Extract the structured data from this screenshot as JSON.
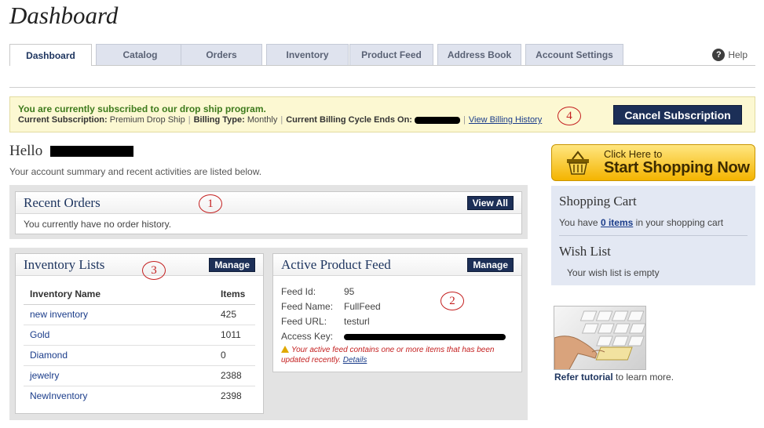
{
  "page": {
    "title": "Dashboard"
  },
  "nav": {
    "tabs": [
      {
        "label": "Dashboard",
        "active": true
      },
      {
        "label": "Catalog"
      },
      {
        "label": "Orders"
      },
      {
        "label": "Inventory"
      },
      {
        "label": "Product Feed"
      },
      {
        "label": "Address Book"
      },
      {
        "label": "Account Settings"
      }
    ],
    "help_label": "Help",
    "help_icon": "question-icon"
  },
  "subscription": {
    "headline": "You are currently subscribed to our drop ship program.",
    "current_label": "Current Subscription:",
    "current_value": "Premium Drop Ship",
    "billing_type_label": "Billing Type:",
    "billing_type_value": "Monthly",
    "cycle_label": "Current Billing Cycle Ends On:",
    "history_link": "View Billing History",
    "cancel_button": "Cancel Subscription"
  },
  "annotations": [
    "1",
    "2",
    "3",
    "4"
  ],
  "greeting": {
    "hello": "Hello",
    "summary": "Your account summary and recent activities are listed below."
  },
  "recent_orders": {
    "title": "Recent Orders",
    "button": "View All",
    "empty_text": "You currently have no order history."
  },
  "inventory_lists": {
    "title": "Inventory Lists",
    "button": "Manage",
    "columns": [
      "Inventory Name",
      "Items"
    ],
    "rows": [
      {
        "name": "new inventory",
        "items": "425"
      },
      {
        "name": "Gold",
        "items": "1011"
      },
      {
        "name": "Diamond",
        "items": "0"
      },
      {
        "name": "jewelry",
        "items": "2388"
      },
      {
        "name": "NewInventory",
        "items": "2398"
      }
    ]
  },
  "product_feed": {
    "title": "Active Product Feed",
    "button": "Manage",
    "fields": [
      {
        "label": "Feed Id:",
        "value": "95"
      },
      {
        "label": "Feed Name:",
        "value": "FullFeed"
      },
      {
        "label": "Feed URL:",
        "value": "testurl"
      },
      {
        "label": "Access Key:",
        "value": ""
      }
    ],
    "warning": "Your active feed contains one or more items that has been updated recently.",
    "warning_link": "Details"
  },
  "shopping": {
    "small_text": "Click Here to",
    "big_text": "Start Shopping Now",
    "basket_icon": "shopping-basket-icon"
  },
  "cart": {
    "title": "Shopping Cart",
    "text_prefix": "You have",
    "items_link": "0 items",
    "text_suffix": "in your shopping cart"
  },
  "wishlist": {
    "title": "Wish List",
    "text": "Your wish list is empty"
  },
  "tutorial": {
    "link": "Refer tutorial",
    "suffix": "to learn more."
  }
}
